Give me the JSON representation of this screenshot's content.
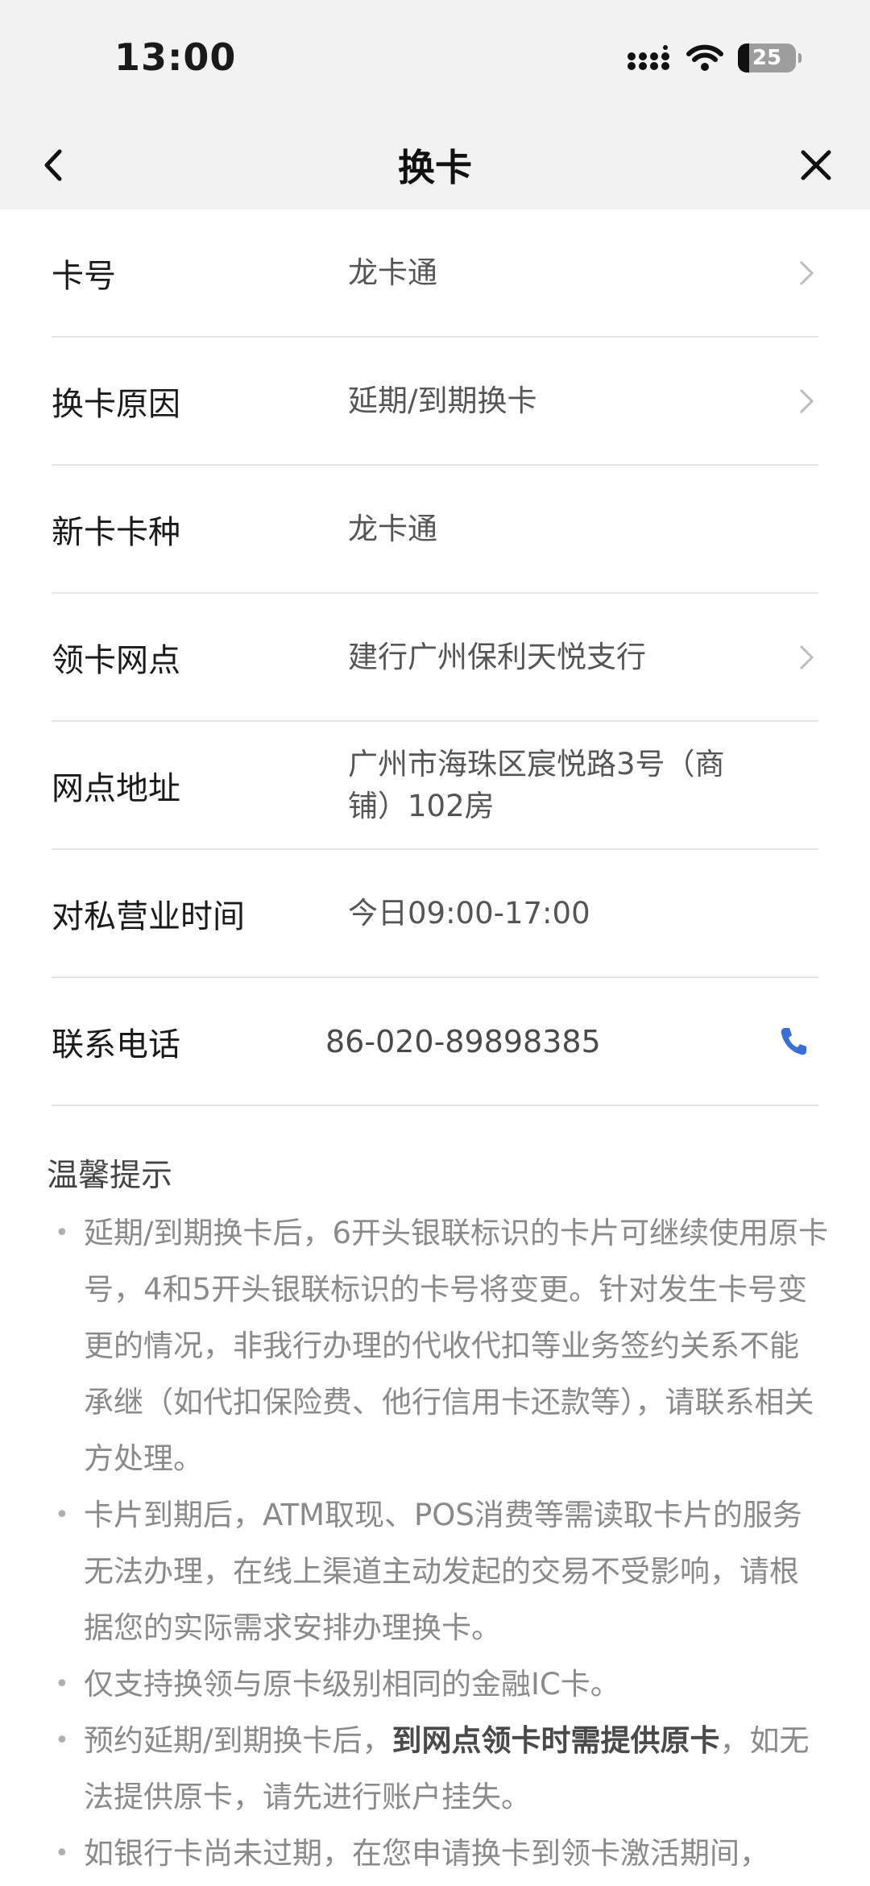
{
  "status_bar": {
    "time": "13:00",
    "battery": "25"
  },
  "nav": {
    "title": "换卡"
  },
  "rows": [
    {
      "label": "卡号",
      "value": "龙卡通"
    },
    {
      "label": "换卡原因",
      "value": "延期/到期换卡"
    },
    {
      "label": "新卡卡种",
      "value": "龙卡通"
    },
    {
      "label": "领卡网点",
      "value": "建行广州保利天悦支行"
    },
    {
      "label": "网点地址",
      "value": "广州市海珠区宸悦路3号（商铺）102房"
    },
    {
      "label": "对私营业时间",
      "value": "今日09:00-17:00"
    },
    {
      "label": "联系电话",
      "value": "86-020-89898385"
    }
  ],
  "tips": {
    "title": "温馨提示",
    "items": [
      "延期/到期换卡后，6开头银联标识的卡片可继续使用原卡号，4和5开头银联标识的卡号将变更。针对发生卡号变更的情况，非我行办理的代收代扣等业务签约关系不能承继（如代扣保险费、他行信用卡还款等），请联系相关方处理。",
      "卡片到期后，ATM取现、POS消费等需读取卡片的服务无法办理，在线上渠道主动发起的交易不受影响，请根据您的实际需求安排办理换卡。",
      "仅支持换领与原卡级别相同的金融IC卡。",
      {
        "before": "预约延期/到期换卡后，",
        "bold": "到网点领卡时需提供原卡",
        "after": "，如无法提供原卡，请先进行账户挂失。"
      },
      "如银行卡尚未过期，在您申请换卡到领卡激活期间，"
    ]
  }
}
